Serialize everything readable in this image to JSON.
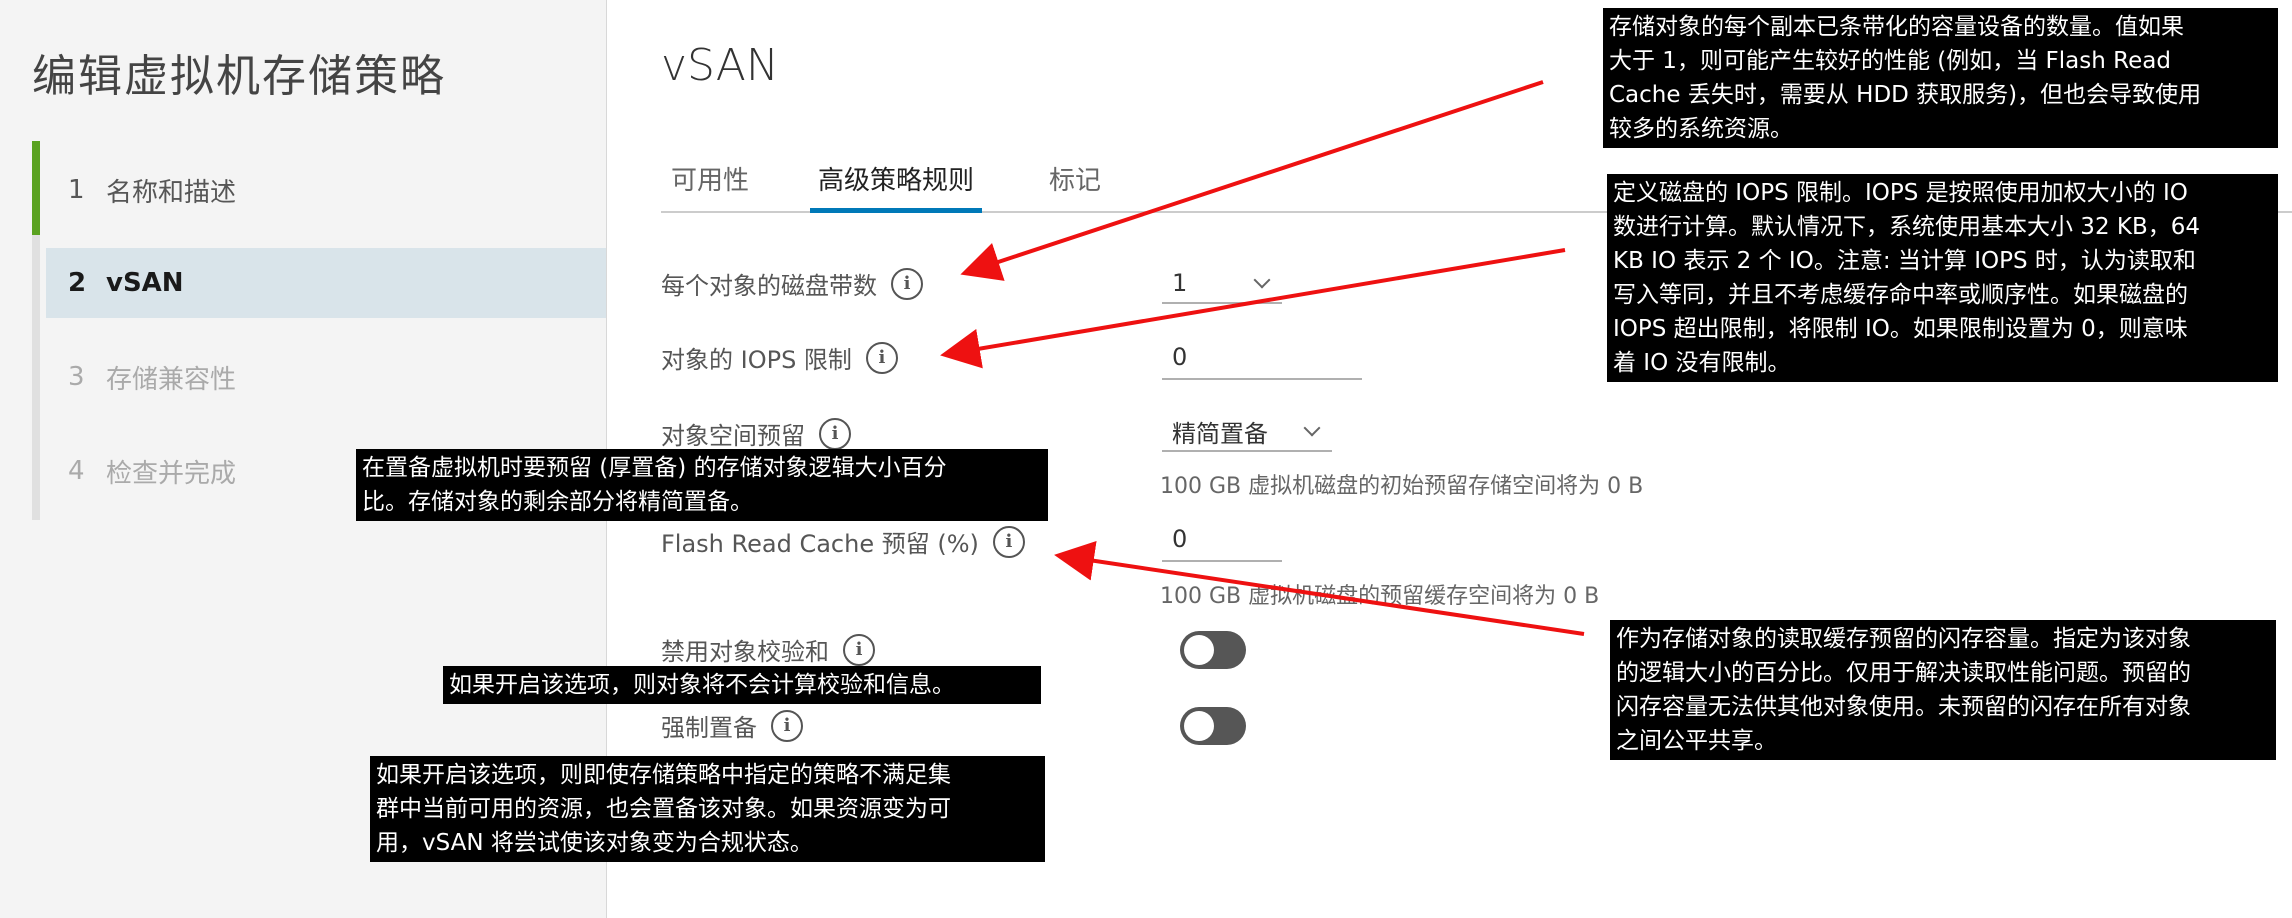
{
  "wizard": {
    "title": "编辑虚拟机存储策略",
    "steps": [
      {
        "num": "1",
        "label": "名称和描述"
      },
      {
        "num": "2",
        "label": "vSAN"
      },
      {
        "num": "3",
        "label": "存储兼容性"
      },
      {
        "num": "4",
        "label": "检查并完成"
      }
    ]
  },
  "main": {
    "title": "vSAN",
    "tabs": [
      {
        "label": "可用性"
      },
      {
        "label": "高级策略规则"
      },
      {
        "label": "标记"
      }
    ],
    "fields": {
      "stripes": {
        "label": "每个对象的磁盘带数",
        "value": "1"
      },
      "iops": {
        "label": "对象的 IOPS 限制",
        "value": "0"
      },
      "space_reservation": {
        "label": "对象空间预留",
        "value": "精简置备",
        "hint": "100 GB 虚拟机磁盘的初始预留存储空间将为 0 B"
      },
      "flash_cache": {
        "label": "Flash Read Cache 预留 (%)",
        "value": "0",
        "hint": "100 GB 虚拟机磁盘的预留缓存空间将为 0 B"
      },
      "disable_checksum": {
        "label": "禁用对象校验和",
        "enabled": false
      },
      "force_provision": {
        "label": "强制置备",
        "enabled": false
      }
    }
  },
  "callouts": {
    "stripes": [
      "存储对象的每个副本已条带化的容量设备的数量。值如果",
      "大于 1，则可能产生较好的性能 (例如，当 Flash Read",
      "Cache 丢失时，需要从 HDD 获取服务)，但也会导致使用",
      "较多的系统资源。"
    ],
    "iops": [
      "定义磁盘的 IOPS 限制。IOPS 是按照使用加权大小的 IO",
      "数进行计算。默认情况下，系统使用基本大小 32 KB，64",
      "KB IO 表示 2 个 IO。注意: 当计算 IOPS 时，认为读取和",
      "写入等同，并且不考虑缓存命中率或顺序性。如果磁盘的",
      "IOPS 超出限制，将限制 IO。如果限制设置为 0，则意味",
      "着 IO 没有限制。"
    ],
    "space_reservation": [
      "在置备虚拟机时要预留 (厚置备) 的存储对象逻辑大小百分",
      "比。存储对象的剩余部分将精简置备。"
    ],
    "flash_cache": [
      "作为存储对象的读取缓存预留的闪存容量。指定为该对象",
      "的逻辑大小的百分比。仅用于解决读取性能问题。预留的",
      "闪存容量无法供其他对象使用。未预留的闪存在所有对象",
      "之间公平共享。"
    ],
    "disable_checksum": [
      "如果开启该选项，则对象将不会计算校验和信息。"
    ],
    "force_provision": [
      "如果开启该选项，则即使存储策略中指定的策略不满足集",
      "群中当前可用的资源，也会置备该对象。如果资源变为可",
      "用，vSAN 将尝试使该对象变为合规状态。"
    ]
  },
  "colors": {
    "accent": "#5aa220",
    "tab_active": "#0079b8",
    "arrow": "#ee1111",
    "callout_bg": "#000000"
  }
}
